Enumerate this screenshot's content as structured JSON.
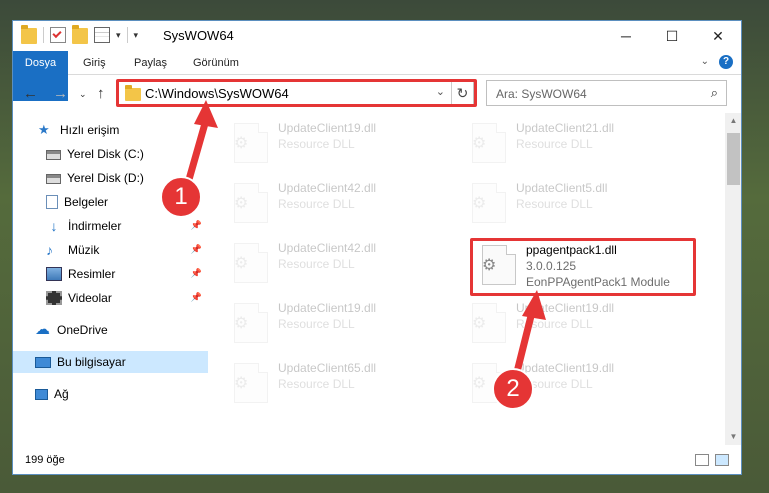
{
  "window": {
    "title": "SysWOW64",
    "controls": {
      "minimize": "─",
      "maximize": "☐",
      "close": "✕"
    }
  },
  "ribbon": {
    "tabs": [
      "Dosya",
      "Giriş",
      "Paylaş",
      "Görünüm"
    ],
    "expand_icon": "chevron-down",
    "help_label": "?"
  },
  "address": {
    "path": "C:\\Windows\\SysWOW64",
    "search_placeholder": "Ara: SysWOW64"
  },
  "sidebar": {
    "items": [
      {
        "label": "Hızlı erişim",
        "icon": "star-icon"
      },
      {
        "label": "Yerel Disk (C:)",
        "icon": "disk-icon"
      },
      {
        "label": "Yerel Disk (D:)",
        "icon": "disk-icon"
      },
      {
        "label": "Belgeler",
        "icon": "documents-icon"
      },
      {
        "label": "İndirmeler",
        "icon": "download-icon"
      },
      {
        "label": "Müzik",
        "icon": "music-icon"
      },
      {
        "label": "Resimler",
        "icon": "pictures-icon"
      },
      {
        "label": "Videolar",
        "icon": "video-icon"
      },
      {
        "label": "OneDrive",
        "icon": "cloud-icon"
      },
      {
        "label": "Bu bilgisayar",
        "icon": "computer-icon"
      },
      {
        "label": "Ağ",
        "icon": "network-icon"
      }
    ]
  },
  "files": [
    {
      "name": "UpdateClient19.dll",
      "type": "Resource DLL"
    },
    {
      "name": "UpdateClient21.dll",
      "type": "Resource DLL"
    },
    {
      "name": "UpdateClient42.dll",
      "type": "Resource DLL"
    },
    {
      "name": "UpdateClient5.dll",
      "type": "Resource DLL"
    },
    {
      "name": "UpdateClient42.dll",
      "type": "Resource DLL"
    },
    {
      "name": "ppagentpack1.dll",
      "version": "3.0.0.125",
      "type": "EonPPAgentPack1 Module"
    },
    {
      "name": "UpdateClient19.dll",
      "type": "Resource DLL"
    },
    {
      "name": "UpdateClient19.dll",
      "type": "Resource DLL"
    },
    {
      "name": "UpdateClient65.dll",
      "type": "Resource DLL"
    },
    {
      "name": "UpdateClient19.dll",
      "type": "Resource DLL"
    }
  ],
  "status": {
    "count": "199 öğe"
  },
  "annotations": {
    "step1": "1",
    "step2": "2",
    "color": "#e53535"
  }
}
